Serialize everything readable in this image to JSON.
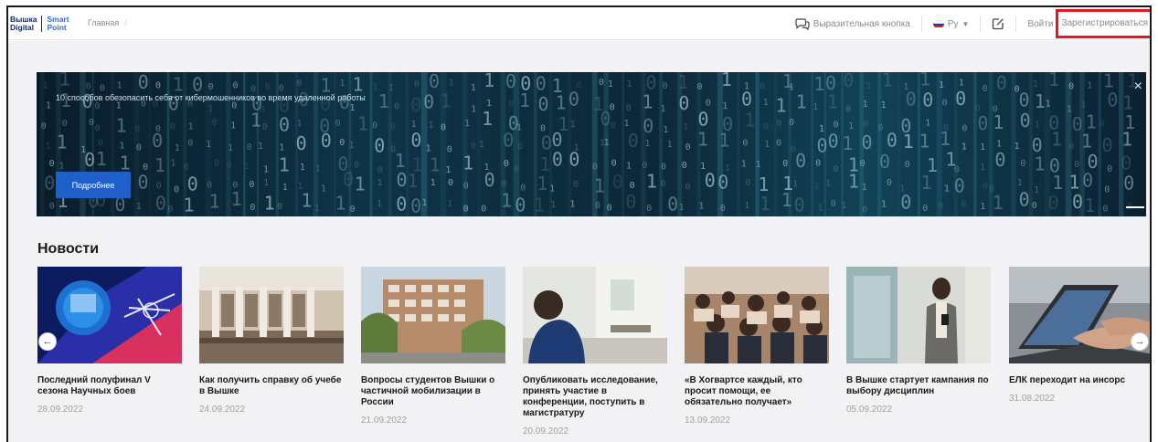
{
  "header": {
    "logo_left_line1": "Вышка",
    "logo_left_line2": "Digital",
    "logo_right_line1": "Smart",
    "logo_right_line2": "Point",
    "breadcrumb_home": "Главная",
    "breadcrumb_sep": "/",
    "chat_button": "Выразительная кнопка",
    "language": "Ру",
    "login": "Войти",
    "register": "Зарегистрироваться"
  },
  "banner": {
    "title": "10 способов обезопасить себя от кибермошенников во время удаленной работы",
    "button": "Подробнее",
    "close": "×"
  },
  "news": {
    "heading": "Новости",
    "items": [
      {
        "title": "Последний полуфинал V сезона Научных боев",
        "date": "28.09.2022"
      },
      {
        "title": "Как получить справку об учебе в Вышке",
        "date": "24.09.2022"
      },
      {
        "title": "Вопросы студентов Вышки о частичной мобилизации в России",
        "date": "21.09.2022"
      },
      {
        "title": "Опубликовать исследование, принять участие в конференции, поступить в магистратуру",
        "date": "20.09.2022"
      },
      {
        "title": "«В Хогвартсе каждый, кто просит помощи, ее обязательно получает»",
        "date": "13.09.2022"
      },
      {
        "title": "В Вышке стартует кампания по выбору дисциплин",
        "date": "05.09.2022"
      },
      {
        "title": "ЕЛК переходит на инсорс",
        "date": "31.08.2022"
      }
    ],
    "prev_arrow": "←",
    "next_arrow": "→"
  },
  "colors": {
    "accent": "#1f5fc9",
    "highlight_box": "#e8141b",
    "background": "#f2f2f4"
  }
}
